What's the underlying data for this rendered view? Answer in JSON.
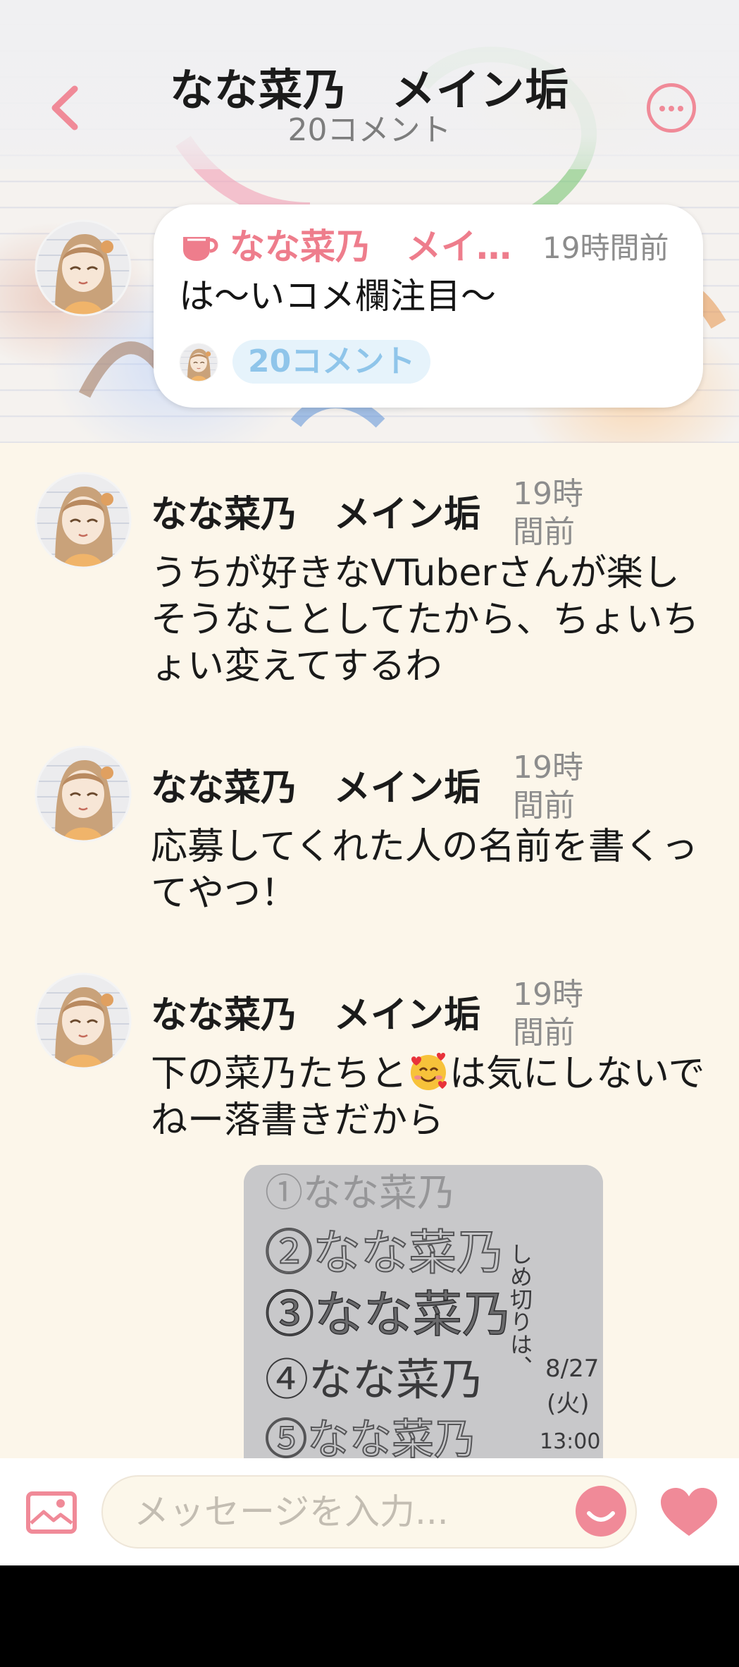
{
  "header": {
    "title": "なな菜乃　メイン垢",
    "subtitle": "20コメント"
  },
  "post": {
    "author": "なな菜乃　メイ…",
    "time": "19時間前",
    "text": "は〜いコメ欄注目〜",
    "comment_count": "20コメント"
  },
  "comments": [
    {
      "author": "なな菜乃　メイン垢",
      "time": "19時間前",
      "text": "うちが好きなVTuberさんが楽しそうなことしてたから、ちょいちょい変えてするわ"
    },
    {
      "author": "なな菜乃　メイン垢",
      "time": "19時間前",
      "text": "応募してくれた人の名前を書くってやつ！"
    },
    {
      "author": "なな菜乃　メイン垢",
      "time": "19時間前",
      "text_before_emoji": "下の菜乃たちと",
      "emoji": "smiling-face-with-hearts",
      "text_after_emoji": "は気にしないでねー落書きだから",
      "attachment": {
        "lines": [
          "①なな菜乃",
          "②なな菜乃",
          "③なな菜乃",
          "④なな菜乃",
          "⑤なな菜乃"
        ],
        "side_note": [
          "しめ切りは、",
          "8/27",
          "(火)",
          "13:00"
        ]
      }
    }
  ],
  "input": {
    "placeholder": "メッセージを入力..."
  },
  "colors": {
    "accent_pink": "#f08a98",
    "background": "#fcf6ea",
    "count_badge_bg": "#e6f3fb",
    "count_badge_text": "#8fc5ea"
  },
  "icons": {
    "back": "chevron-left-icon",
    "more": "more-dots-icon",
    "cup": "cup-icon",
    "image": "image-icon",
    "stamp": "smile-stamp-icon",
    "like": "heart-icon"
  }
}
